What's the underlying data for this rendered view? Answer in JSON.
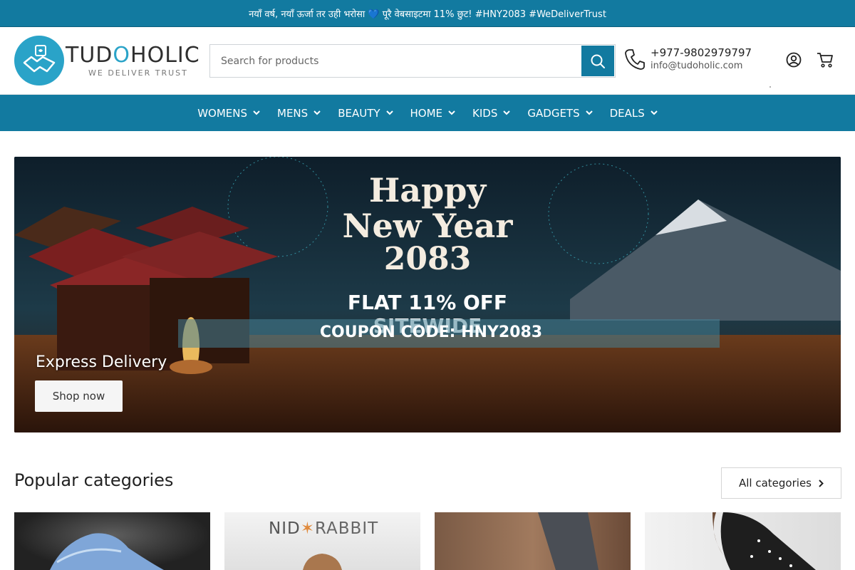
{
  "announcement": "नयाँ वर्ष, नयाँ ऊर्जा तर उही भरोसा 💙 पूरै वेबसाइटमा 11% छुट! #HNY2083 #WeDeliverTrust",
  "logo": {
    "name_part1": "TUD",
    "name_o": "O",
    "name_part2": "HOLIC",
    "tagline": "WE DELIVER TRUST"
  },
  "search": {
    "placeholder": "Search for products",
    "icon": "search-icon"
  },
  "contact": {
    "phone": "+977-9802979797",
    "email": "info@tudoholic.com",
    "icon": "phone-icon"
  },
  "header_icons": [
    "account-icon",
    "cart-icon"
  ],
  "nav": {
    "items": [
      {
        "label": "WOMENS"
      },
      {
        "label": "MENS"
      },
      {
        "label": "BEAUTY"
      },
      {
        "label": "HOME"
      },
      {
        "label": "KIDS"
      },
      {
        "label": "GADGETS"
      },
      {
        "label": "DEALS"
      }
    ]
  },
  "hero": {
    "line1": "Happy",
    "line2": "New Year",
    "line3": "2083",
    "offer": "FLAT 11% OFF SITEWIDE",
    "coupon": "COUPON CODE: HNY2083",
    "subtitle": "Express Delivery",
    "button": "Shop now"
  },
  "categories": {
    "heading": "Popular categories",
    "all_button": "All categories",
    "brand_text_1": "NID",
    "brand_text_2": "RABBIT"
  },
  "colors": {
    "brand": "#127aa0",
    "logo_blue": "#2aa3c8"
  }
}
